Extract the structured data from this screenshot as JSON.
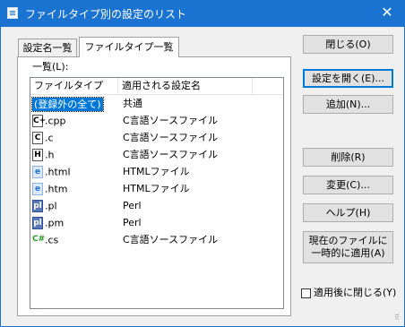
{
  "window": {
    "title": "ファイルタイプ別の設定のリスト",
    "close_glyph": "✕"
  },
  "tabs": [
    {
      "label": "設定名一覧"
    },
    {
      "label": "ファイルタイプ一覧"
    }
  ],
  "list": {
    "label": "一覧(L):",
    "columns": [
      "ファイルタイプ",
      "適用される設定名"
    ],
    "rows": [
      {
        "type": "(登録外の全て)",
        "setting": "共通",
        "icon": ""
      },
      {
        "type": ".cpp",
        "setting": "C言語ソースファイル",
        "icon": "cpp-file-icon",
        "glyph": "C+"
      },
      {
        "type": ".c",
        "setting": "C言語ソースファイル",
        "icon": "c-file-icon",
        "glyph": "C"
      },
      {
        "type": ".h",
        "setting": "C言語ソースファイル",
        "icon": "h-file-icon",
        "glyph": "H"
      },
      {
        "type": ".html",
        "setting": "HTMLファイル",
        "icon": "html-file-icon",
        "glyph": "e"
      },
      {
        "type": ".htm",
        "setting": "HTMLファイル",
        "icon": "html-file-icon",
        "glyph": "e"
      },
      {
        "type": ".pl",
        "setting": "Perl",
        "icon": "perl-file-icon",
        "glyph": "pl"
      },
      {
        "type": ".pm",
        "setting": "Perl",
        "icon": "perl-file-icon",
        "glyph": "pl"
      },
      {
        "type": ".cs",
        "setting": "C言語ソースファイル",
        "icon": "csharp-file-icon",
        "glyph": "C#"
      }
    ]
  },
  "buttons": {
    "close": "閉じる(O)",
    "open_settings": "設定を開く(E)...",
    "add": "追加(N)...",
    "delete": "削除(R)",
    "change": "変更(C)...",
    "help": "ヘルプ(H)",
    "apply_temp_line1": "現在のファイルに",
    "apply_temp_line2": "一時的に適用(A)"
  },
  "checkbox": {
    "label": "適用後に閉じる(Y)",
    "checked": false
  },
  "colors": {
    "titlebar": "#1a73d0",
    "selection": "#0078d7"
  }
}
